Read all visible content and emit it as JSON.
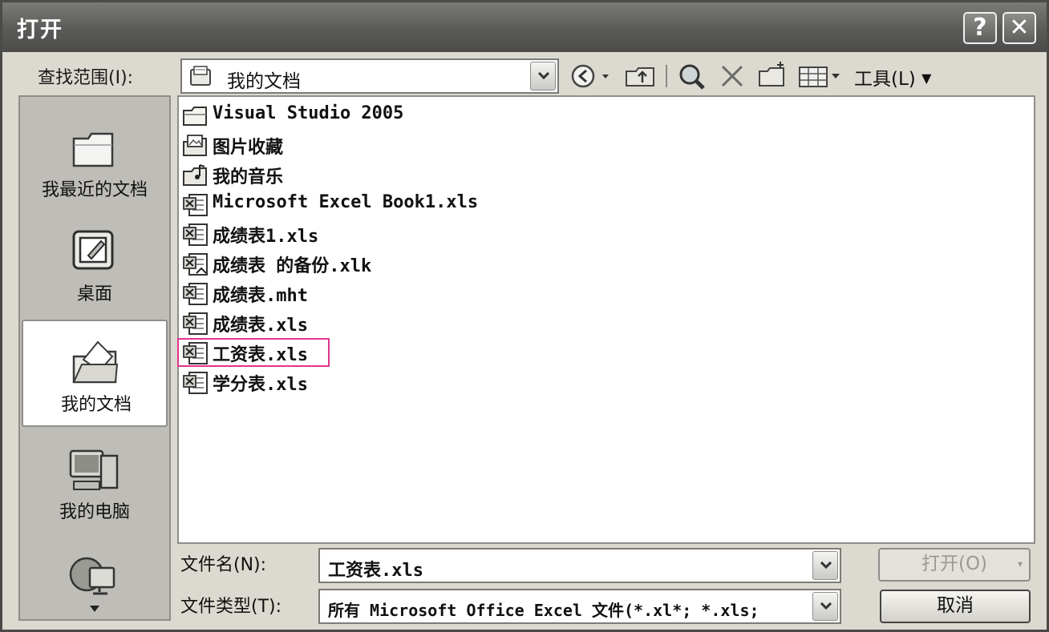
{
  "window": {
    "title": "打开",
    "help_label": "?",
    "close_label": "✕"
  },
  "lookin": {
    "label": "查找范围(I):",
    "value": "我的文档"
  },
  "toolbar": {
    "tools_label": "工具(L)",
    "icons": [
      "back-icon",
      "up-folder-icon",
      "search-web-icon",
      "delete-icon",
      "new-folder-icon",
      "views-icon"
    ]
  },
  "places": [
    {
      "label": "我最近的文档",
      "icon": "recent-docs-icon"
    },
    {
      "label": "桌面",
      "icon": "desktop-icon"
    },
    {
      "label": "我的文档",
      "icon": "my-documents-icon",
      "selected": true
    },
    {
      "label": "我的电脑",
      "icon": "my-computer-icon"
    },
    {
      "label": "",
      "icon": "network-places-icon"
    }
  ],
  "files": [
    {
      "name": "Visual Studio 2005",
      "type": "folder"
    },
    {
      "name": "图片收藏",
      "type": "pictures-folder"
    },
    {
      "name": "我的音乐",
      "type": "music-folder"
    },
    {
      "name": "Microsoft Excel Book1.xls",
      "type": "excel"
    },
    {
      "name": "成绩表1.xls",
      "type": "excel"
    },
    {
      "name": "成绩表 的备份.xlk",
      "type": "excel-backup"
    },
    {
      "name": "成绩表.mht",
      "type": "excel"
    },
    {
      "name": "成绩表.xls",
      "type": "excel"
    },
    {
      "name": "工资表.xls",
      "type": "excel",
      "highlighted": true
    },
    {
      "name": "学分表.xls",
      "type": "excel"
    }
  ],
  "filename": {
    "label": "文件名(N):",
    "value": "工资表.xls"
  },
  "filetype": {
    "label": "文件类型(T):",
    "value": "所有 Microsoft Office Excel 文件(*.xl*; *.xls;"
  },
  "buttons": {
    "open_label": "打开(O)",
    "cancel_label": "取消"
  },
  "colors": {
    "highlight": "#e0358c",
    "titlebar": "#5a5a58"
  }
}
